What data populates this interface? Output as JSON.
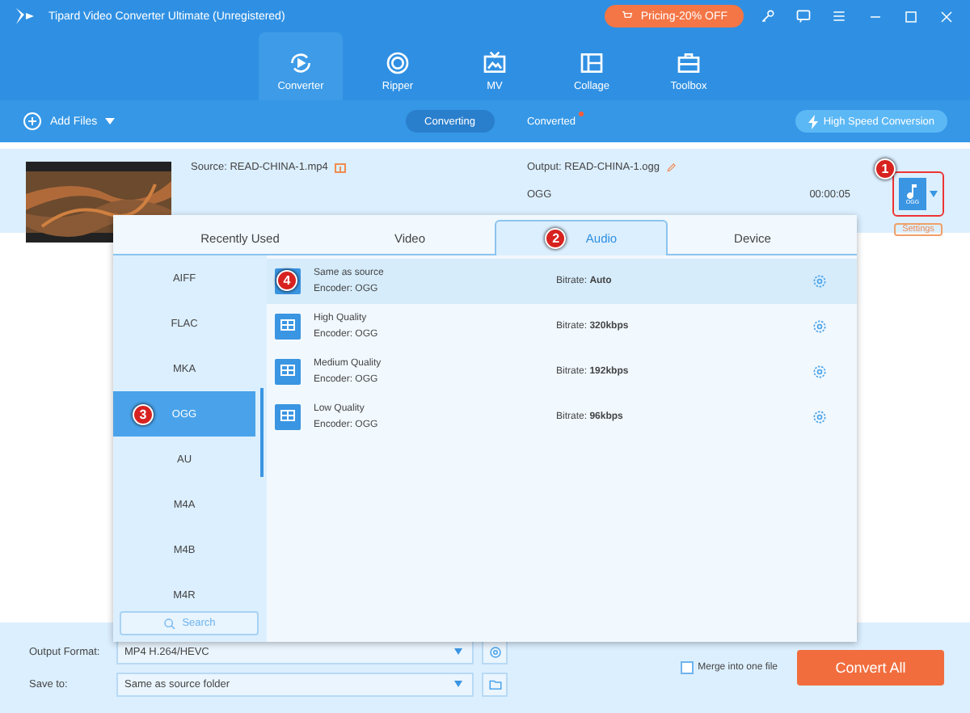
{
  "window": {
    "title": "Tipard Video Converter Ultimate (Unregistered)",
    "pricing": "Pricing-20% OFF"
  },
  "nav": [
    {
      "label": "Converter",
      "selected": true
    },
    {
      "label": "Ripper",
      "selected": false
    },
    {
      "label": "MV",
      "selected": false
    },
    {
      "label": "Collage",
      "selected": false
    },
    {
      "label": "Toolbox",
      "selected": false
    }
  ],
  "toolbar": {
    "add_files": "Add Files",
    "views": [
      {
        "label": "Converting",
        "selected": true,
        "new_dot": false
      },
      {
        "label": "Converted",
        "selected": false,
        "new_dot": true
      }
    ],
    "high_speed": "High Speed Conversion"
  },
  "file": {
    "source": "Source: READ-CHINA-1.mp4",
    "output": "Output: READ-CHINA-1.ogg",
    "format": "OGG",
    "duration": "00:00:05",
    "format_icon_label": "OGG",
    "settings": "Settings"
  },
  "popup": {
    "tabs": [
      {
        "label": "Recently Used",
        "selected": false
      },
      {
        "label": "Video",
        "selected": false
      },
      {
        "label": "Audio",
        "selected": true,
        "step": "2"
      },
      {
        "label": "Device",
        "selected": false
      }
    ],
    "formats": [
      {
        "label": "AIFF",
        "selected": false
      },
      {
        "label": "FLAC",
        "selected": false
      },
      {
        "label": "MKA",
        "selected": false
      },
      {
        "label": "OGG",
        "selected": true,
        "step": "3"
      },
      {
        "label": "AU",
        "selected": false
      },
      {
        "label": "M4A",
        "selected": false
      },
      {
        "label": "M4B",
        "selected": false
      },
      {
        "label": "M4R",
        "selected": false
      }
    ],
    "search_placeholder": "Search",
    "presets": [
      {
        "name": "Same as source",
        "encoder": "Encoder: OGG",
        "bitrate_label": "Bitrate:",
        "bitrate": "Auto",
        "selected": true,
        "step": "4"
      },
      {
        "name": "High Quality",
        "encoder": "Encoder: OGG",
        "bitrate_label": "Bitrate:",
        "bitrate": "320kbps",
        "selected": false
      },
      {
        "name": "Medium Quality",
        "encoder": "Encoder: OGG",
        "bitrate_label": "Bitrate:",
        "bitrate": "192kbps",
        "selected": false
      },
      {
        "name": "Low Quality",
        "encoder": "Encoder: OGG",
        "bitrate_label": "Bitrate:",
        "bitrate": "96kbps",
        "selected": false
      }
    ]
  },
  "format_step": "1",
  "bottom": {
    "output_format_label": "Output Format:",
    "output_format": "MP4 H.264/HEVC",
    "save_to_label": "Save to:",
    "save_to": "Same as source folder",
    "merge": {
      "label": "Merge into one file",
      "checked": false
    },
    "convert_all": "Convert All"
  }
}
